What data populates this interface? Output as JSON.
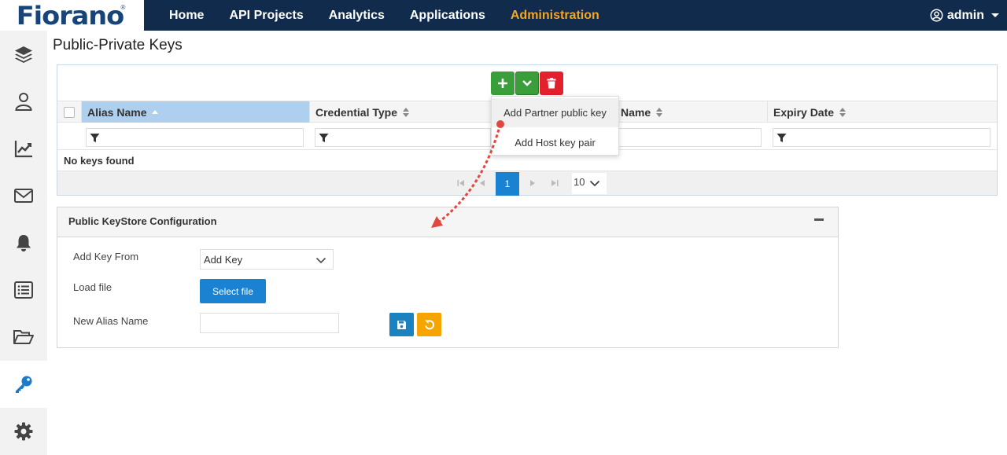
{
  "brand": {
    "logo_text": "Fiorano",
    "logo_mark": "®"
  },
  "nav": {
    "items": [
      {
        "label": "Home"
      },
      {
        "label": "API Projects"
      },
      {
        "label": "Analytics"
      },
      {
        "label": "Applications"
      },
      {
        "label": "Administration"
      }
    ],
    "active": "Administration",
    "user": "admin"
  },
  "sidebar": {
    "items": [
      {
        "icon": "layers-icon"
      },
      {
        "icon": "user-icon"
      },
      {
        "icon": "analytics-chart-icon"
      },
      {
        "icon": "mail-icon"
      },
      {
        "icon": "bell-icon"
      },
      {
        "icon": "list-icon"
      },
      {
        "icon": "folder-open-icon"
      },
      {
        "icon": "key-icon",
        "active": true
      },
      {
        "icon": "gear-icon"
      }
    ]
  },
  "page": {
    "title": "Public-Private Keys"
  },
  "grid": {
    "columns": [
      {
        "label": "Alias Name"
      },
      {
        "label": "Credential Type"
      },
      {
        "label": "Name"
      },
      {
        "label": "Expiry Date"
      }
    ],
    "empty_message": "No keys found",
    "pager": {
      "current_page": "1",
      "page_size": "10"
    }
  },
  "add_menu": {
    "items": [
      {
        "label": "Add Partner public key"
      },
      {
        "label": "Add Host key pair"
      }
    ]
  },
  "config": {
    "title": "Public KeyStore Configuration",
    "add_key_from_label": "Add Key From",
    "add_key_from_value": "Add Key",
    "load_file_label": "Load file",
    "select_file_button": "Select file",
    "new_alias_label": "New Alias Name",
    "new_alias_value": ""
  },
  "colors": {
    "nav_bg": "#102b4c",
    "nav_active": "#f5a623",
    "add_green": "#3a9e3a",
    "delete_red": "#e2202e",
    "primary_blue": "#1b82d1",
    "reset_orange": "#f5a400",
    "annotation_red": "#e0473d"
  }
}
